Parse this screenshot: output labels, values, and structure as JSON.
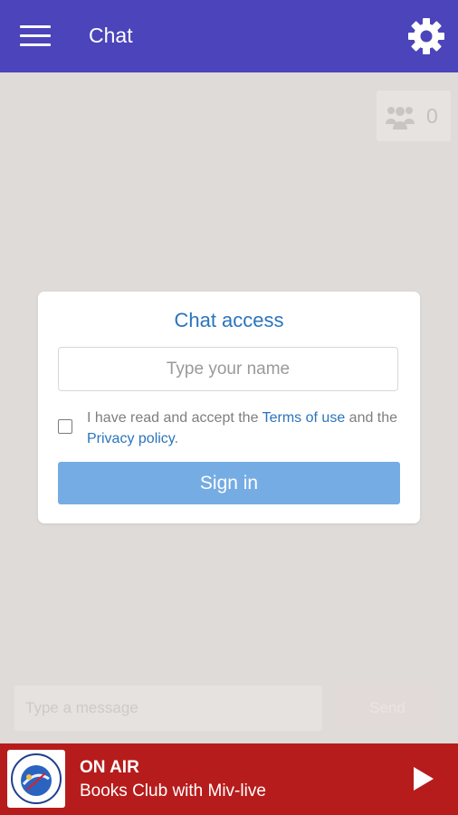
{
  "appbar": {
    "title": "Chat"
  },
  "users": {
    "count": "0"
  },
  "dialog": {
    "title": "Chat access",
    "name_placeholder": "Type your name",
    "consent_prefix": "I have read and accept the ",
    "terms_link": "Terms of use",
    "consent_middle": " and the ",
    "privacy_link": "Privacy policy",
    "consent_suffix": ".",
    "signin_label": "Sign in"
  },
  "composer": {
    "placeholder": "Type a message",
    "send_label": "Send"
  },
  "player": {
    "status": "ON AIR",
    "show": "Books Club with Miv-live"
  },
  "colors": {
    "appbar": "#4b44bb",
    "accent": "#2a74bd",
    "signin": "#75ace3",
    "player": "#b71c1c",
    "background": "#dedbd8"
  },
  "icons": [
    "menu-icon",
    "gear-icon",
    "users-icon",
    "play-icon"
  ]
}
